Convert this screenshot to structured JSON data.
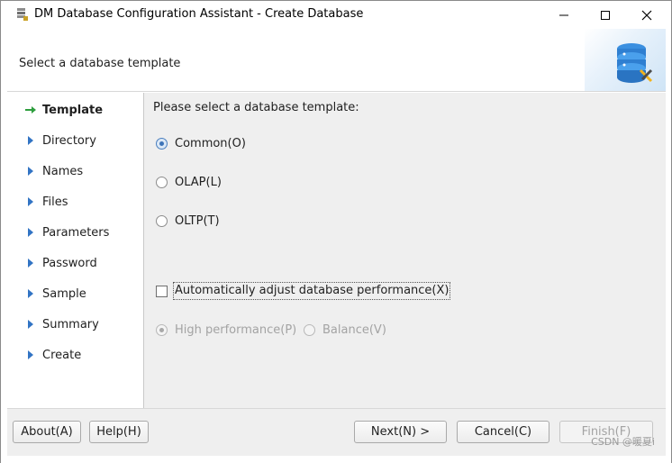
{
  "window": {
    "title": "DM Database Configuration Assistant - Create Database",
    "controls": {
      "minimize_icon": "minimize-icon",
      "maximize_icon": "maximize-icon",
      "close_icon": "close-icon"
    }
  },
  "header": {
    "title": "Select a database template",
    "art_icon": "database-tools-icon"
  },
  "steps": [
    {
      "label": "Template",
      "active": true
    },
    {
      "label": "Directory",
      "active": false
    },
    {
      "label": "Names",
      "active": false
    },
    {
      "label": "Files",
      "active": false
    },
    {
      "label": "Parameters",
      "active": false
    },
    {
      "label": "Password",
      "active": false
    },
    {
      "label": "Sample",
      "active": false
    },
    {
      "label": "Summary",
      "active": false
    },
    {
      "label": "Create",
      "active": false
    }
  ],
  "main": {
    "prompt": "Please select a database template:",
    "templates": [
      {
        "label": "Common(O)",
        "checked": true
      },
      {
        "label": "OLAP(L)",
        "checked": false
      },
      {
        "label": "OLTP(T)",
        "checked": false
      }
    ],
    "auto_adjust": {
      "label": "Automatically adjust database performance(X)",
      "checked": false
    },
    "performance": [
      {
        "label": "High performance(P)",
        "checked": true,
        "disabled": true
      },
      {
        "label": "Balance(V)",
        "checked": false,
        "disabled": true
      }
    ]
  },
  "footer": {
    "about": "About(A)",
    "help": "Help(H)",
    "next": "Next(N) >",
    "cancel": "Cancel(C)",
    "finish": "Finish(F)"
  },
  "watermark": "CSDN @暖夏i",
  "colors": {
    "active_arrow": "#2e9e3e",
    "step_arrow": "#3274c4",
    "radio_accent": "#3d74b8"
  }
}
